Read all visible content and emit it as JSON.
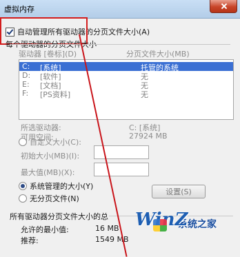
{
  "window": {
    "title": "虚拟内存"
  },
  "auto_manage": {
    "label": "自动管理所有驱动器的分页文件大小(A)",
    "checked": true
  },
  "group": {
    "label": "每个驱动器的分页文件大小"
  },
  "drive_list": {
    "col_drive": "驱动器 [卷标](D)",
    "col_size": "分页文件大小(MB)",
    "rows": [
      {
        "drive": "C:",
        "label": "[系统]",
        "size": "托管的系统",
        "selected": true
      },
      {
        "drive": "D:",
        "label": "[软件]",
        "size": "无",
        "selected": false
      },
      {
        "drive": "E:",
        "label": "[文档]",
        "size": "无",
        "selected": false
      },
      {
        "drive": "F:",
        "label": "[PS资料]",
        "size": "无",
        "selected": false
      }
    ]
  },
  "selected_info": {
    "drive_label": "所选驱动器:",
    "drive_value": "C:  [系统]",
    "space_label": "可用空间:",
    "space_value": "27924 MB"
  },
  "custom": {
    "label": "自定义大小(C):",
    "initial_label": "初始大小(MB)(I):",
    "max_label": "最大值(MB)(X):"
  },
  "system_managed": {
    "label": "系统管理的大小(Y)",
    "checked": true
  },
  "no_paging": {
    "label": "无分页文件(N)"
  },
  "set_button": {
    "label": "设置(S)"
  },
  "total": {
    "label": "所有驱动器分页文件大小的总",
    "min_label": "允许的最小值:",
    "min_value": "16 MB",
    "rec_label": "推荐:",
    "rec_value": "1549 MB"
  },
  "watermark": {
    "logo": "WinZ",
    "site": "系统之家"
  }
}
